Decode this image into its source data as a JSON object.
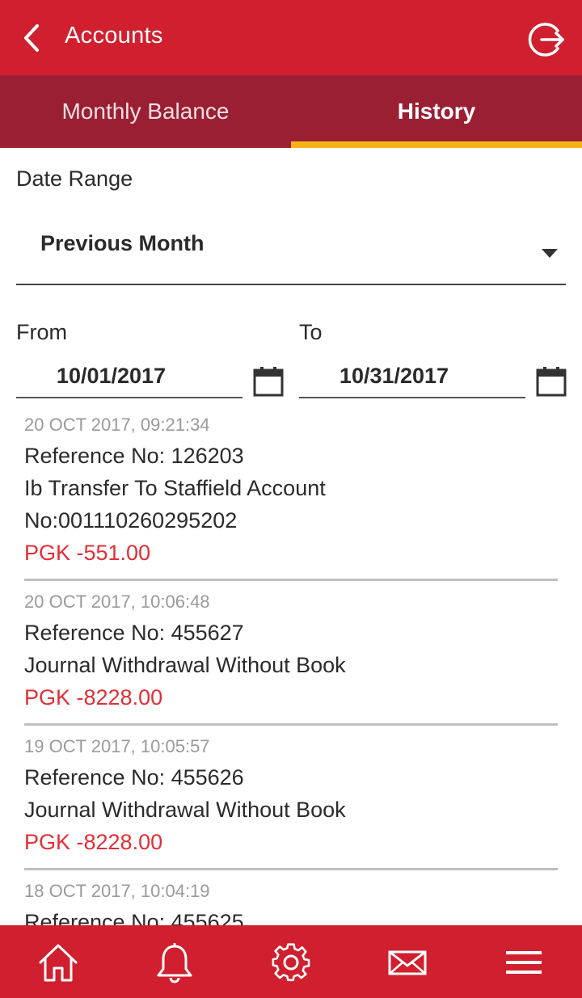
{
  "header": {
    "title": "Accounts",
    "back_icon": "chevron-left-icon",
    "logout_icon": "logout-icon"
  },
  "tabs": [
    {
      "label": "Monthly Balance",
      "selected": false
    },
    {
      "label": "History",
      "selected": true
    }
  ],
  "filters": {
    "date_range_label": "Date Range",
    "date_range_value": "Previous Month",
    "from_label": "From",
    "from_value": "10/01/2017",
    "to_label": "To",
    "to_value": "10/31/2017"
  },
  "transactions": [
    {
      "datetime": "20 OCT 2017, 09:21:34",
      "reference": "Reference No: 126203",
      "description_line1": "Ib Transfer To Staffield Account",
      "description_line2": "No:001110260295202",
      "amount": "PGK -551.00"
    },
    {
      "datetime": "20 OCT 2017, 10:06:48",
      "reference": "Reference No: 455627",
      "description_line1": "Journal Withdrawal Without Book",
      "amount": "PGK -8228.00"
    },
    {
      "datetime": "19 OCT 2017, 10:05:57",
      "reference": "Reference No: 455626",
      "description_line1": "Journal Withdrawal Without Book",
      "amount": "PGK -8228.00"
    },
    {
      "datetime": "18 OCT 2017, 10:04:19",
      "reference": "Reference No: 455625"
    }
  ],
  "bottom_nav": [
    "home-icon",
    "bell-icon",
    "gear-icon",
    "mail-icon",
    "menu-icon"
  ],
  "colors": {
    "primary_red": "#d01f2e",
    "tab_bar": "#9a1f33",
    "tab_indicator": "#f5b318",
    "negative_amount": "#e12f35"
  }
}
